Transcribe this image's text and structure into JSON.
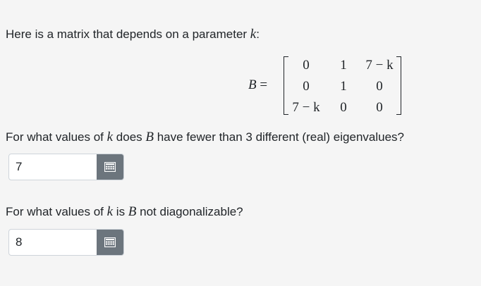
{
  "intro": {
    "text": "Here is a matrix that depends on a parameter ",
    "var": "k",
    "colon": ":"
  },
  "matrix": {
    "label": "B",
    "equals": " =",
    "rows": [
      [
        "0",
        "1",
        "7 − k"
      ],
      [
        "0",
        "1",
        "0"
      ],
      [
        "7 − k",
        "0",
        "0"
      ]
    ]
  },
  "question1": {
    "pre": "For what values of ",
    "var1": "k",
    "mid": " does ",
    "var2": "B",
    "post": " have fewer than 3 different (real) eigenvalues?",
    "answer_value": "7"
  },
  "question2": {
    "pre": "For what values of ",
    "var1": "k",
    "mid": " is ",
    "var2": "B",
    "post": " not diagonalizable?",
    "answer_value": "8"
  },
  "icons": {
    "preview": "keypad-icon"
  },
  "colors": {
    "button": "#6c757d",
    "background": "#f5f5f5",
    "text": "#212529"
  }
}
